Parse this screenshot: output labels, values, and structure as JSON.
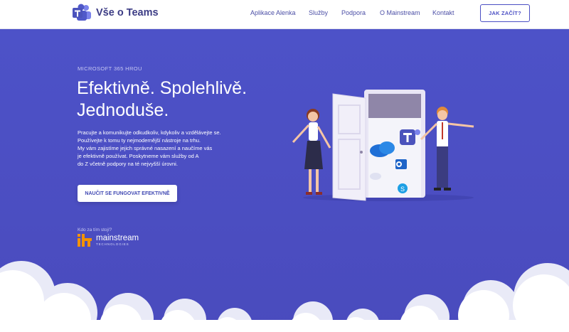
{
  "header": {
    "brand": "Vše o Teams",
    "nav": [
      {
        "label": "Aplikace Alenka"
      },
      {
        "label": "Služby"
      },
      {
        "label": "Podpora"
      },
      {
        "label": "O Mainstream"
      },
      {
        "label": "Kontakt"
      }
    ],
    "cta_label": "JAK ZAČÍT?"
  },
  "hero": {
    "eyebrow": "MICROSOFT 365 HROU",
    "headline_line1": "Efektivně. Spolehlivě.",
    "headline_line2": "Jednoduše.",
    "paragraph": [
      "Pracujte a komunikujte odkudkoliv, kdykoliv a vzdělávejte se.",
      "Používejte k tomu ty nejmodernější nástroje na trhu.",
      "My vám zajistíme jejich správné nasazení a naučíme vás",
      "je efektivně používat. Poskytneme vám služby od A",
      "do Z včetně podpory na té nejvyšší úrovni."
    ],
    "cta_label": "NAUČIT SE FUNGOVAT EFEKTIVNĚ",
    "who_label": "Kdo za tím stojí?",
    "partner_name": "mainstream",
    "partner_sub": "TECHNOLOGIES"
  },
  "colors": {
    "hero_bg": "#4b4fc4",
    "brand_text": "#3c3c85",
    "teams_purple": "#5b5fc7",
    "mainstream_orange": "#f39200"
  },
  "icons": [
    "teams-logo-icon",
    "mainstream-logo-icon",
    "teams-app-icon",
    "outlook-icon",
    "skype-icon",
    "onedrive-icon",
    "cloud-icon"
  ]
}
